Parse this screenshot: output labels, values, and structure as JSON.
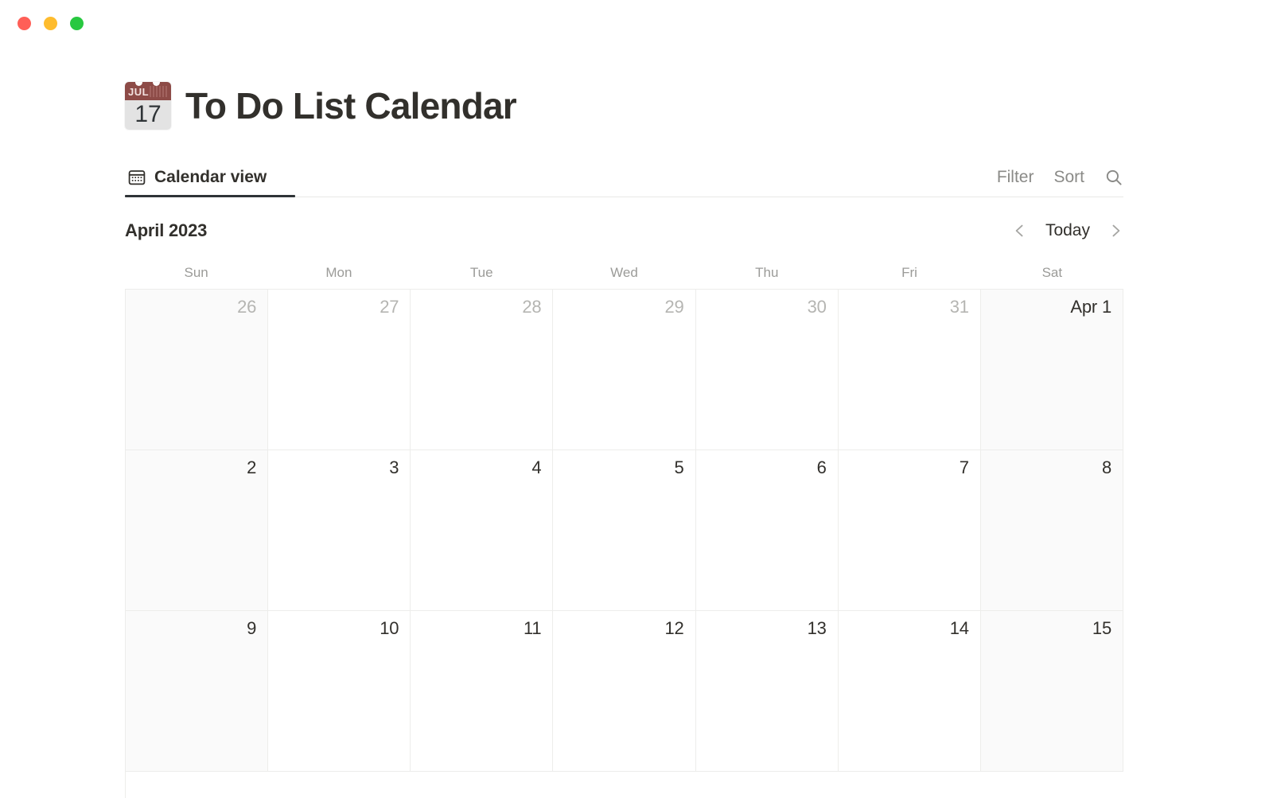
{
  "window": {
    "traffic_lights": [
      {
        "name": "close",
        "color": "#ff5f57"
      },
      {
        "name": "minimize",
        "color": "#febc2e"
      },
      {
        "name": "maximize",
        "color": "#28c840"
      }
    ]
  },
  "header": {
    "icon": "calendar-emoji",
    "icon_month": "JUL",
    "icon_day": "17",
    "title": "To Do List Calendar"
  },
  "toolbar": {
    "tabs": [
      {
        "label": "Calendar view",
        "icon": "calendar-view-icon",
        "active": true
      }
    ],
    "filter_label": "Filter",
    "sort_label": "Sort",
    "search_icon": "search-icon"
  },
  "calendar": {
    "month_label": "April 2023",
    "prev_icon": "chevron-left-icon",
    "today_label": "Today",
    "next_icon": "chevron-right-icon",
    "weekdays": [
      "Sun",
      "Mon",
      "Tue",
      "Wed",
      "Thu",
      "Fri",
      "Sat"
    ],
    "weeks": [
      [
        {
          "label": "26",
          "muted": true,
          "weekend": true
        },
        {
          "label": "27",
          "muted": true,
          "weekend": false
        },
        {
          "label": "28",
          "muted": true,
          "weekend": false
        },
        {
          "label": "29",
          "muted": true,
          "weekend": false
        },
        {
          "label": "30",
          "muted": true,
          "weekend": false
        },
        {
          "label": "31",
          "muted": true,
          "weekend": false
        },
        {
          "label": "Apr 1",
          "muted": false,
          "weekend": true
        }
      ],
      [
        {
          "label": "2",
          "muted": false,
          "weekend": true
        },
        {
          "label": "3",
          "muted": false,
          "weekend": false
        },
        {
          "label": "4",
          "muted": false,
          "weekend": false
        },
        {
          "label": "5",
          "muted": false,
          "weekend": false
        },
        {
          "label": "6",
          "muted": false,
          "weekend": false
        },
        {
          "label": "7",
          "muted": false,
          "weekend": false
        },
        {
          "label": "8",
          "muted": false,
          "weekend": true
        }
      ],
      [
        {
          "label": "9",
          "muted": false,
          "weekend": true
        },
        {
          "label": "10",
          "muted": false,
          "weekend": false
        },
        {
          "label": "11",
          "muted": false,
          "weekend": false
        },
        {
          "label": "12",
          "muted": false,
          "weekend": false
        },
        {
          "label": "13",
          "muted": false,
          "weekend": false
        },
        {
          "label": "14",
          "muted": false,
          "weekend": false
        },
        {
          "label": "15",
          "muted": false,
          "weekend": true
        }
      ]
    ]
  },
  "colors": {
    "text_primary": "#32302c",
    "text_muted": "#9b9b98",
    "date_muted": "#b5b5b2",
    "grid_line": "#ededeb",
    "weekend_bg": "#fafafa",
    "accent_underline": "#2f3437"
  }
}
